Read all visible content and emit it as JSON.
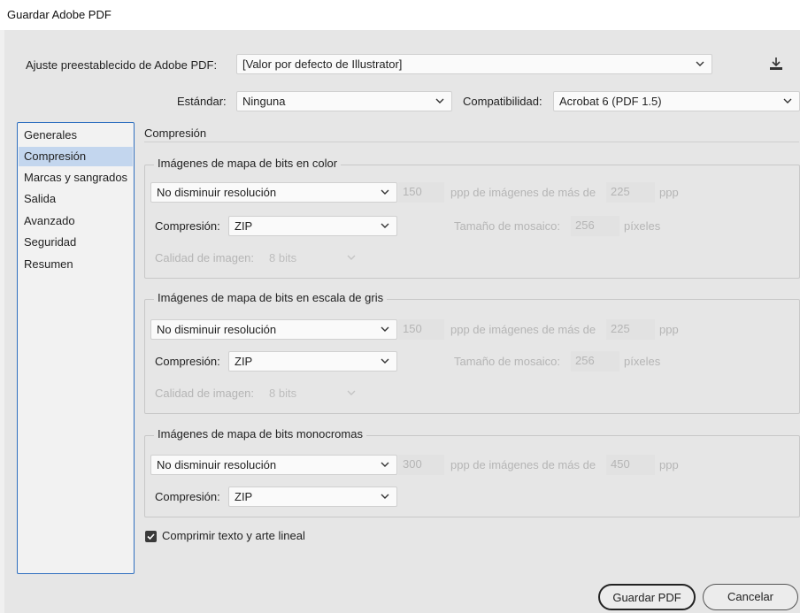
{
  "window": {
    "title": "Guardar Adobe PDF"
  },
  "top": {
    "preset_label": "Ajuste preestablecido de Adobe PDF:",
    "preset_value": "[Valor por defecto de Illustrator]",
    "standard_label": "Estándar:",
    "standard_value": "Ninguna",
    "compat_label": "Compatibilidad:",
    "compat_value": "Acrobat 6 (PDF 1.5)",
    "save_preset_icon": "download-icon"
  },
  "sidebar": {
    "items": [
      {
        "label": "Generales"
      },
      {
        "label": "Compresión",
        "active": true
      },
      {
        "label": "Marcas y sangrados"
      },
      {
        "label": "Salida"
      },
      {
        "label": "Avanzado"
      },
      {
        "label": "Seguridad"
      },
      {
        "label": "Resumen"
      }
    ]
  },
  "main": {
    "section_title": "Compresión",
    "color": {
      "title": "Imágenes de mapa de bits en color",
      "downsample": "No disminuir resolución",
      "ppi": "150",
      "above_label": "ppp de imágenes de más de",
      "above_value": "225",
      "above_unit": "ppp",
      "compression_label": "Compresión:",
      "compression_value": "ZIP",
      "tile_label": "Tamaño de mosaico:",
      "tile_value": "256",
      "tile_unit": "píxeles",
      "quality_label": "Calidad de imagen:",
      "quality_value": "8 bits"
    },
    "gray": {
      "title": "Imágenes de mapa de bits en escala de gris",
      "downsample": "No disminuir resolución",
      "ppi": "150",
      "above_label": "ppp de imágenes de más de",
      "above_value": "225",
      "above_unit": "ppp",
      "compression_label": "Compresión:",
      "compression_value": "ZIP",
      "tile_label": "Tamaño de mosaico:",
      "tile_value": "256",
      "tile_unit": "píxeles",
      "quality_label": "Calidad de imagen:",
      "quality_value": "8 bits"
    },
    "mono": {
      "title": "Imágenes de mapa de bits monocromas",
      "downsample": "No disminuir resolución",
      "ppi": "300",
      "above_label": "ppp de imágenes de más de",
      "above_value": "450",
      "above_unit": "ppp",
      "compression_label": "Compresión:",
      "compression_value": "ZIP"
    },
    "compress_text_label": "Comprimir texto y arte lineal",
    "compress_text_checked": true
  },
  "footer": {
    "save_label": "Guardar PDF",
    "cancel_label": "Cancelar"
  }
}
